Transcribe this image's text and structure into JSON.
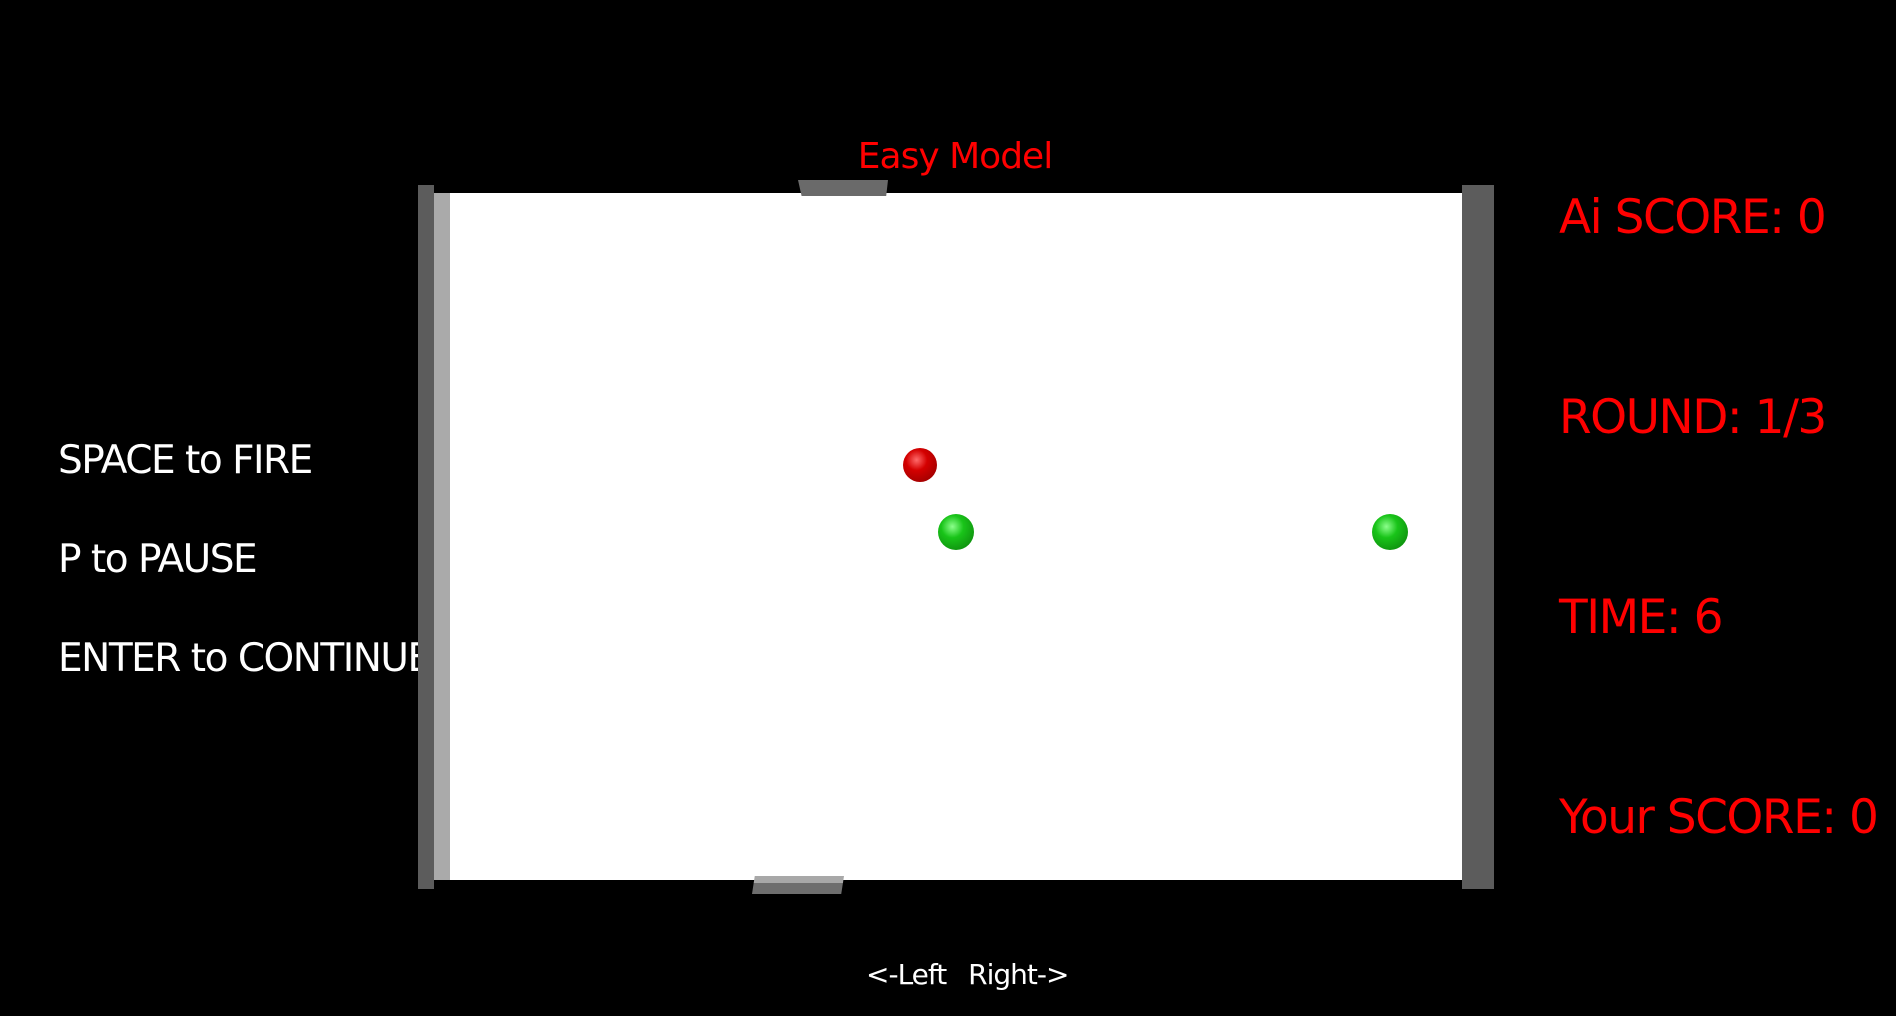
{
  "title": "Easy Model",
  "instructions": {
    "fire": "SPACE to FIRE",
    "pause": "P to PAUSE",
    "continue": "ENTER to CONTINUE"
  },
  "hud": {
    "ai_score": "Ai SCORE: 0",
    "round": "ROUND: 1/3",
    "time": "TIME: 6",
    "your_score": "Your SCORE: 0"
  },
  "controls": "<-Left Right->",
  "colors": {
    "background": "#000000",
    "field": "#ffffff",
    "hud_text": "#ff0000",
    "instruction_text": "#ffffff",
    "wall": "#5c5c5c",
    "ball_enemy": "#d40000",
    "ball_player": "#19c419"
  }
}
